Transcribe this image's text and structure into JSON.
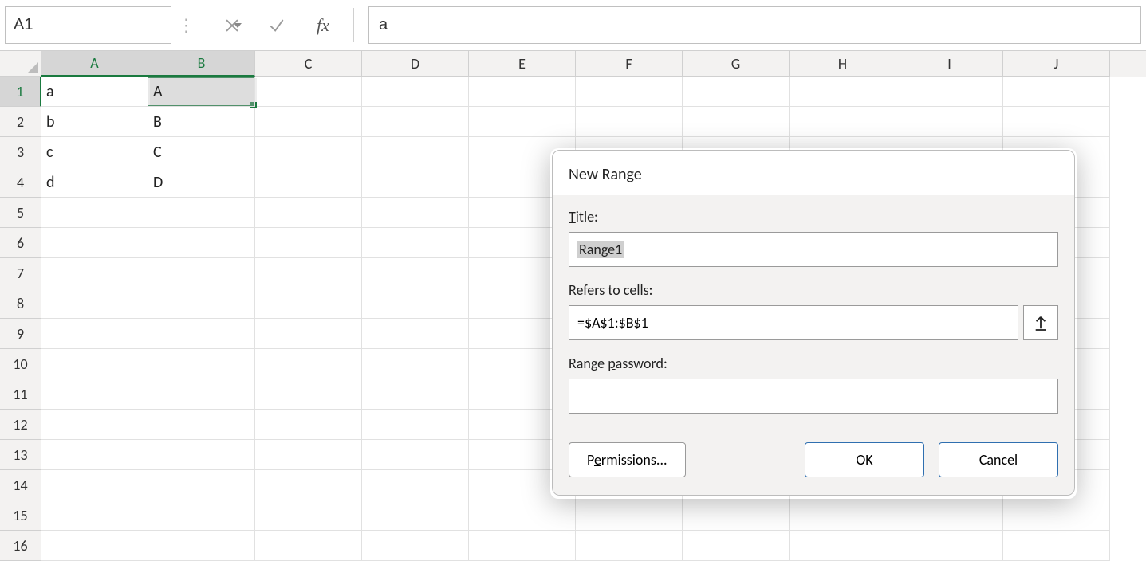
{
  "namebox": {
    "value": "A1"
  },
  "formula_bar": {
    "value": "a"
  },
  "columns": [
    "A",
    "B",
    "C",
    "D",
    "E",
    "F",
    "G",
    "H",
    "I",
    "J"
  ],
  "selected_cols": [
    "A",
    "B"
  ],
  "row_count": 16,
  "selected_rows": [
    1
  ],
  "cells": {
    "A1": "a",
    "B1": "A",
    "A2": "b",
    "B2": "B",
    "A3": "c",
    "B3": "C",
    "A4": "d",
    "B4": "D"
  },
  "dialog": {
    "title": "New Range",
    "labels": {
      "title_prefix": "T",
      "title_rest": "itle:",
      "refers_prefix": "R",
      "refers_rest": "efers to cells:",
      "password_pre": "Range ",
      "password_u": "p",
      "password_post": "assword:"
    },
    "title_value": "Range1",
    "refers_value": "=$A$1:$B$1",
    "password_value": "",
    "buttons": {
      "permissions_pre": "P",
      "permissions_u": "e",
      "permissions_post": "rmissions...",
      "ok": "OK",
      "cancel": "Cancel"
    }
  }
}
